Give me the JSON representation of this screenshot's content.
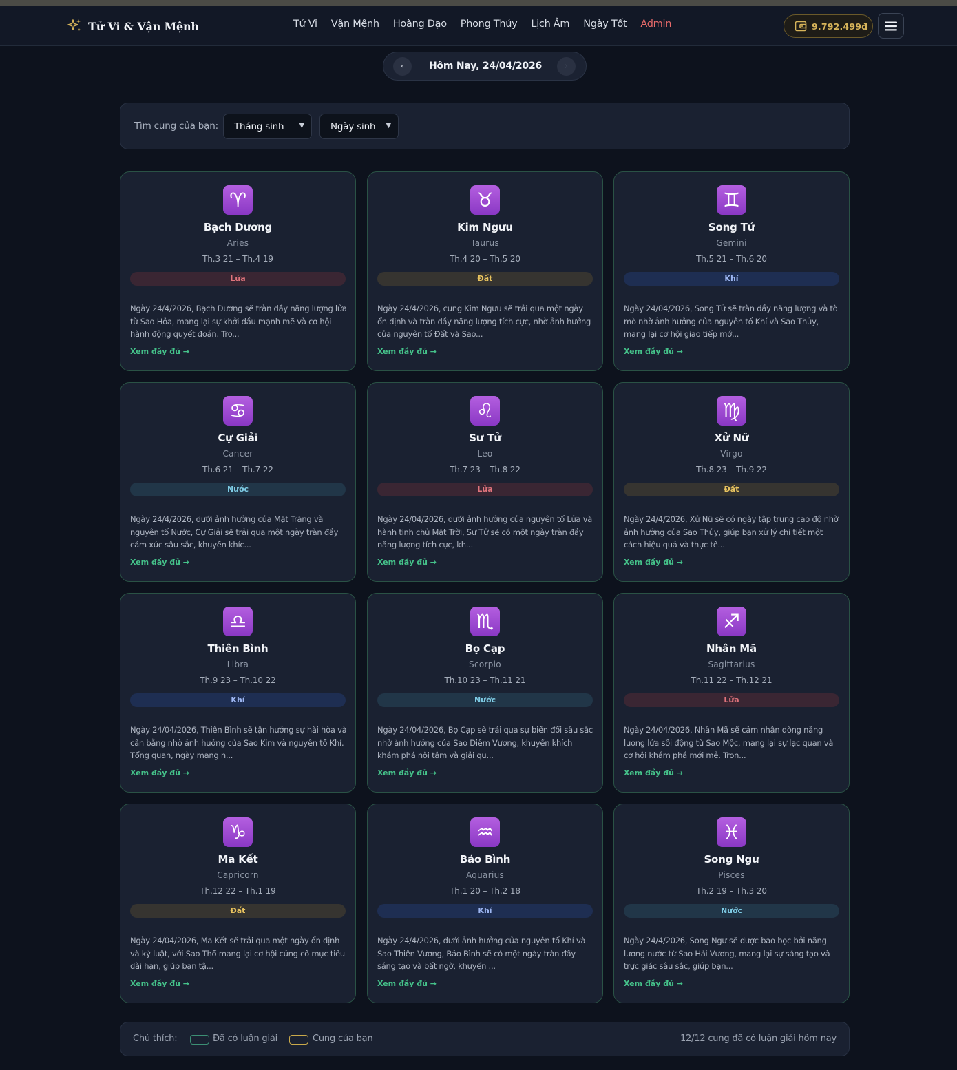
{
  "nav": {
    "brand": "Tử Vi & Vận Mệnh",
    "links": [
      "Tử Vi",
      "Vận Mệnh",
      "Hoàng Đạo",
      "Phong Thủy",
      "Lịch Âm",
      "Ngày Tốt",
      "Admin"
    ],
    "wallet": "9.792.499đ",
    "icons": {
      "brand": "sparkle-icon",
      "wallet": "wallet-icon",
      "menu": "hamburger-menu-icon"
    }
  },
  "date_nav": {
    "label": "Hôm Nay, 24/04/2026",
    "prev": "‹",
    "next": "›"
  },
  "finder": {
    "label": "Tìm cung của bạn:",
    "month_select": "Tháng sinh",
    "day_select": "Ngày sinh"
  },
  "signs": [
    {
      "symbol": "♈",
      "name": "Bạch Dương",
      "latin": "Aries",
      "range": "Th.3 21 – Th.4 19",
      "element": "Lửa",
      "element_type": "fire",
      "desc": "Ngày 24/4/2026, Bạch Dương sẽ tràn đầy năng lượng lửa từ Sao Hỏa, mang lại sự khởi đầu mạnh mẽ và cơ hội hành động quyết đoán. Tro...",
      "more": "Xem đầy đủ →"
    },
    {
      "symbol": "♉",
      "name": "Kim Ngưu",
      "latin": "Taurus",
      "range": "Th.4 20 – Th.5 20",
      "element": "Đất",
      "element_type": "earth",
      "desc": "Ngày 24/4/2026, cung Kim Ngưu sẽ trải qua một ngày ổn định và tràn đầy năng lượng tích cực, nhờ ảnh hưởng của nguyên tố Đất và Sao...",
      "more": "Xem đầy đủ →"
    },
    {
      "symbol": "♊",
      "name": "Song Tử",
      "latin": "Gemini",
      "range": "Th.5 21 – Th.6 20",
      "element": "Khí",
      "element_type": "air",
      "desc": "Ngày 24/04/2026, Song Tử sẽ tràn đầy năng lượng và tò mò nhờ ảnh hưởng của nguyên tố Khí và Sao Thủy, mang lại cơ hội giao tiếp mớ...",
      "more": "Xem đầy đủ →"
    },
    {
      "symbol": "♋",
      "name": "Cự Giải",
      "latin": "Cancer",
      "range": "Th.6 21 – Th.7 22",
      "element": "Nước",
      "element_type": "water",
      "desc": "Ngày 24/4/2026, dưới ảnh hưởng của Mặt Trăng và nguyên tố Nước, Cự Giải sẽ trải qua một ngày tràn đầy cảm xúc sâu sắc, khuyến khíc...",
      "more": "Xem đầy đủ →"
    },
    {
      "symbol": "♌",
      "name": "Sư Tử",
      "latin": "Leo",
      "range": "Th.7 23 – Th.8 22",
      "element": "Lửa",
      "element_type": "fire",
      "desc": "Ngày 24/04/2026, dưới ảnh hưởng của nguyên tố Lửa và hành tinh chủ Mặt Trời, Sư Tử sẽ có một ngày tràn đầy năng lượng tích cực, kh...",
      "more": "Xem đầy đủ →"
    },
    {
      "symbol": "♍",
      "name": "Xử Nữ",
      "latin": "Virgo",
      "range": "Th.8 23 – Th.9 22",
      "element": "Đất",
      "element_type": "earth",
      "desc": "Ngày 24/4/2026, Xử Nữ sẽ có ngày tập trung cao độ nhờ ảnh hưởng của Sao Thủy, giúp bạn xử lý chi tiết một cách hiệu quả và thực tế...",
      "more": "Xem đầy đủ →"
    },
    {
      "symbol": "♎",
      "name": "Thiên Bình",
      "latin": "Libra",
      "range": "Th.9 23 – Th.10 22",
      "element": "Khí",
      "element_type": "air",
      "desc": "Ngày 24/04/2026, Thiên Bình sẽ tận hưởng sự hài hòa và cân bằng nhờ ảnh hưởng của Sao Kim và nguyên tố Khí. Tổng quan, ngày mang n...",
      "more": "Xem đầy đủ →"
    },
    {
      "symbol": "♏",
      "name": "Bọ Cạp",
      "latin": "Scorpio",
      "range": "Th.10 23 – Th.11 21",
      "element": "Nước",
      "element_type": "water",
      "desc": "Ngày 24/04/2026, Bọ Cạp sẽ trải qua sự biến đổi sâu sắc nhờ ảnh hưởng của Sao Diêm Vương, khuyến khích khám phá nội tâm và giải qu...",
      "more": "Xem đầy đủ →"
    },
    {
      "symbol": "♐",
      "name": "Nhân Mã",
      "latin": "Sagittarius",
      "range": "Th.11 22 – Th.12 21",
      "element": "Lửa",
      "element_type": "fire",
      "desc": "Ngày 24/04/2026, Nhân Mã sẽ cảm nhận dòng năng lượng lửa sôi động từ Sao Mộc, mang lại sự lạc quan và cơ hội khám phá mới mẻ. Tron...",
      "more": "Xem đầy đủ →"
    },
    {
      "symbol": "♑",
      "name": "Ma Kết",
      "latin": "Capricorn",
      "range": "Th.12 22 – Th.1 19",
      "element": "Đất",
      "element_type": "earth",
      "desc": "Ngày 24/04/2026, Ma Kết sẽ trải qua một ngày ổn định và kỷ luật, với Sao Thổ mang lại cơ hội củng cố mục tiêu dài hạn, giúp bạn tậ...",
      "more": "Xem đầy đủ →"
    },
    {
      "symbol": "♒",
      "name": "Bảo Bình",
      "latin": "Aquarius",
      "range": "Th.1 20 – Th.2 18",
      "element": "Khí",
      "element_type": "air",
      "desc": "Ngày 24/4/2026, dưới ảnh hưởng của nguyên tố Khí và Sao Thiên Vương, Bảo Bình sẽ có một ngày tràn đầy sáng tạo và bất ngờ, khuyến ...",
      "more": "Xem đầy đủ →"
    },
    {
      "symbol": "♓",
      "name": "Song Ngư",
      "latin": "Pisces",
      "range": "Th.2 19 – Th.3 20",
      "element": "Nước",
      "element_type": "water",
      "desc": "Ngày 24/4/2026, Song Ngư sẽ được bao bọc bởi năng lượng nước từ Sao Hải Vương, mang lại sự sáng tạo và trực giác sâu sắc, giúp bạn...",
      "more": "Xem đầy đủ →"
    }
  ],
  "legend": {
    "label": "Chú thích:",
    "has_reading": "Đã có luận giải",
    "your_sign": "Cung của bạn",
    "count": "12/12 cung đã có luận giải hôm nay"
  },
  "colors": {
    "accent_green": "#45c28a",
    "gold": "#d7b45a",
    "admin_red": "#e86a6a",
    "icon_purple": "#a24fd8"
  }
}
